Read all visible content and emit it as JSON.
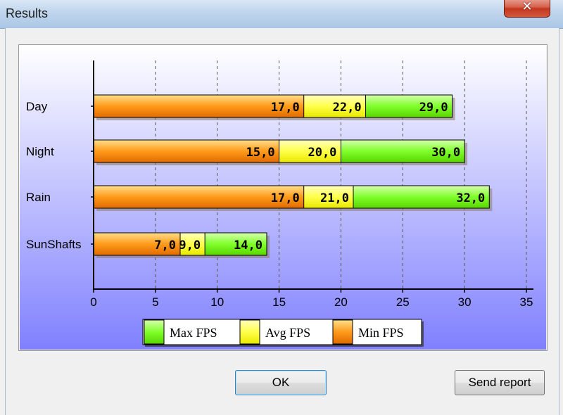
{
  "window": {
    "title": "Results",
    "close_glyph": "✕"
  },
  "buttons": {
    "ok_label": "OK",
    "send_report_label": "Send report"
  },
  "colors": {
    "max_fps": "#7fff2a",
    "avg_fps": "#ffff4a",
    "min_fps": "#ff9a1a",
    "plot_bg_top": "#ffffff",
    "plot_bg_bottom": "#8080ff"
  },
  "chart_data": {
    "type": "bar",
    "orientation": "horizontal",
    "stacked": true,
    "categories": [
      "Day",
      "Night",
      "Rain",
      "SunShafts"
    ],
    "series": [
      {
        "name": "Min FPS",
        "values": [
          17.0,
          15.0,
          17.0,
          7.0
        ],
        "labels": [
          "17,0",
          "15,0",
          "17,0",
          "7,0"
        ]
      },
      {
        "name": "Avg FPS",
        "values": [
          22.0,
          20.0,
          21.0,
          9.0
        ],
        "labels": [
          "22,0",
          "20,0",
          "21,0",
          "9,0"
        ]
      },
      {
        "name": "Max FPS",
        "values": [
          29.0,
          30.0,
          32.0,
          14.0
        ],
        "labels": [
          "29,0",
          "30,0",
          "32,0",
          "14,0"
        ]
      }
    ],
    "xlim": [
      0,
      35
    ],
    "xticks": [
      0,
      5,
      10,
      15,
      20,
      25,
      30,
      35
    ],
    "grid": "vertical-dashed",
    "legend": {
      "placement": "bottom",
      "entries": [
        "Max FPS",
        "Avg FPS",
        "Min FPS"
      ]
    }
  }
}
